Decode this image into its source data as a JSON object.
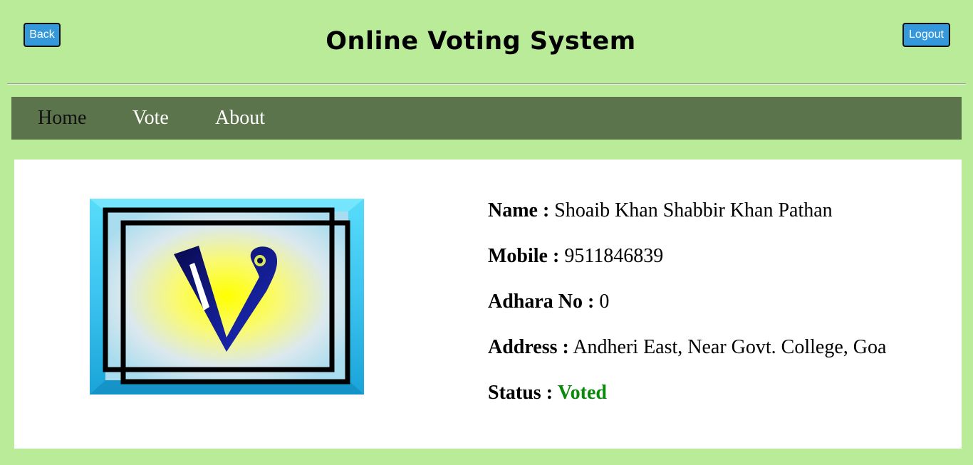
{
  "header": {
    "back_label": "Back",
    "logout_label": "Logout",
    "title": "Online Voting System"
  },
  "nav": {
    "items": [
      {
        "label": "Home",
        "active": true
      },
      {
        "label": "Vote",
        "active": false
      },
      {
        "label": "About",
        "active": false
      }
    ]
  },
  "voter": {
    "name_label": "Name :",
    "name": "Shoaib Khan Shabbir Khan Pathan",
    "mobile_label": "Mobile :",
    "mobile": "9511846839",
    "adhara_label": "Adhara No :",
    "adhara": "0",
    "address_label": "Address :",
    "address": "Andheri East, Near Govt. College, Goa",
    "status_label": "Status :",
    "status": "Voted"
  },
  "colors": {
    "page_bg": "#b9eb98",
    "nav_bg": "#5c744c",
    "button_bg": "#3498db",
    "status_voted": "#0a8a0a"
  },
  "icons": {
    "logo": "voting-logo-icon"
  }
}
